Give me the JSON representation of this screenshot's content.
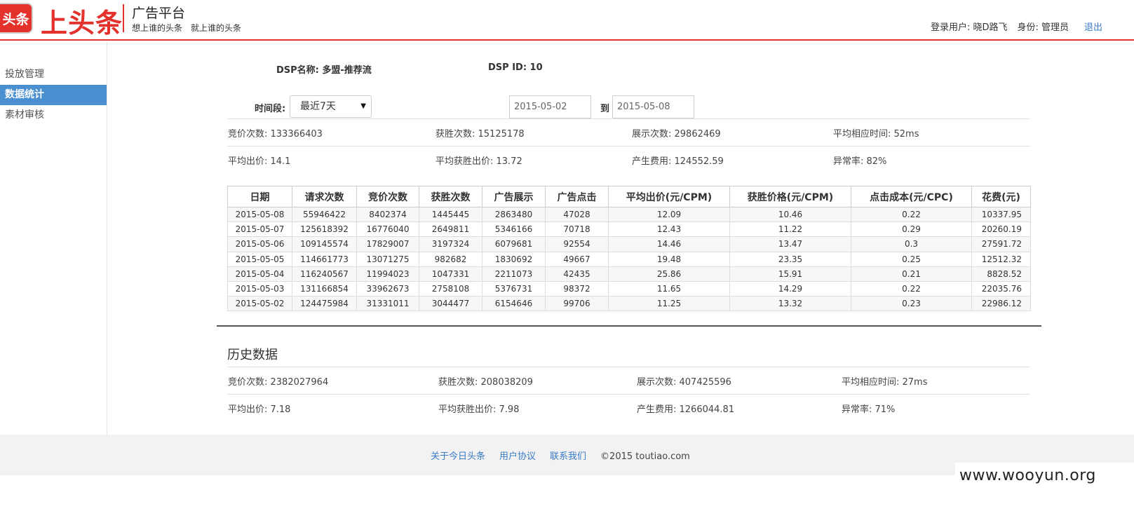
{
  "header": {
    "logo_badge": "头条",
    "logo_text": "上头条",
    "platform_title": "广告平台",
    "slogan_1": "想上谁的头条",
    "slogan_2": "就上谁的头条",
    "login_user": "登录用户: 晓D路飞",
    "role": "身份: 管理员",
    "logout": "退出"
  },
  "sidebar": {
    "items": [
      {
        "label": "投放管理",
        "active": false
      },
      {
        "label": "数据统计",
        "active": true
      },
      {
        "label": "素材审核",
        "active": false
      }
    ]
  },
  "dsp": {
    "name": "DSP名称: 多盟-推荐流",
    "id": "DSP ID: 10"
  },
  "filter": {
    "period_label": "时间段:",
    "period_value": "最近7天",
    "start_date": "2015-05-02",
    "to_label": "到",
    "end_date": "2015-05-08"
  },
  "summary": {
    "bids": "竞价次数: 133366403",
    "wins": "获胜次数: 15125178",
    "impressions": "展示次数: 29862469",
    "avg_response": "平均相应时间: 52ms",
    "avg_bid": "平均出价: 14.1",
    "avg_win_bid": "平均获胜出价: 13.72",
    "cost": "产生费用: 124552.59",
    "error_rate": "异常率: 82%"
  },
  "table": {
    "headers": [
      "日期",
      "请求次数",
      "竞价次数",
      "获胜次数",
      "广告展示",
      "广告点击",
      "平均出价(元/CPM)",
      "获胜价格(元/CPM)",
      "点击成本(元/CPC)",
      "花费(元)"
    ],
    "rows": [
      [
        "2015-05-08",
        "55946422",
        "8402374",
        "1445445",
        "2863480",
        "47028",
        "12.09",
        "10.46",
        "0.22",
        "10337.95"
      ],
      [
        "2015-05-07",
        "125618392",
        "16776040",
        "2649811",
        "5346166",
        "70718",
        "12.43",
        "11.22",
        "0.29",
        "20260.19"
      ],
      [
        "2015-05-06",
        "109145574",
        "17829007",
        "3197324",
        "6079681",
        "92554",
        "14.46",
        "13.47",
        "0.3",
        "27591.72"
      ],
      [
        "2015-05-05",
        "114661773",
        "13071275",
        "982682",
        "1830692",
        "49667",
        "19.48",
        "23.35",
        "0.25",
        "12512.32"
      ],
      [
        "2015-05-04",
        "116240567",
        "11994023",
        "1047331",
        "2211073",
        "42435",
        "25.86",
        "15.91",
        "0.21",
        "8828.52"
      ],
      [
        "2015-05-03",
        "131166854",
        "33962673",
        "2758108",
        "5376731",
        "98372",
        "11.65",
        "14.29",
        "0.22",
        "22035.76"
      ],
      [
        "2015-05-02",
        "124475984",
        "31331011",
        "3044477",
        "6154646",
        "99706",
        "11.25",
        "13.32",
        "0.23",
        "22986.12"
      ]
    ]
  },
  "history": {
    "title": "历史数据",
    "bids": "竞价次数: 2382027964",
    "wins": "获胜次数: 208038209",
    "impressions": "展示次数: 407425596",
    "avg_response": "平均相应时间: 27ms",
    "avg_bid": "平均出价: 7.18",
    "avg_win_bid": "平均获胜出价: 7.98",
    "cost": "产生费用: 1266044.81",
    "error_rate": "异常率: 71%"
  },
  "footer": {
    "link_about": "关于今日头条",
    "link_agreement": "用户协议",
    "link_contact": "联系我们",
    "copyright": "©2015 toutiao.com"
  },
  "watermark": "www.wooyun.org",
  "colors": {
    "brand_red": "#e3312b",
    "active_blue": "#4a90d0",
    "link_blue": "#3a7cc7"
  }
}
